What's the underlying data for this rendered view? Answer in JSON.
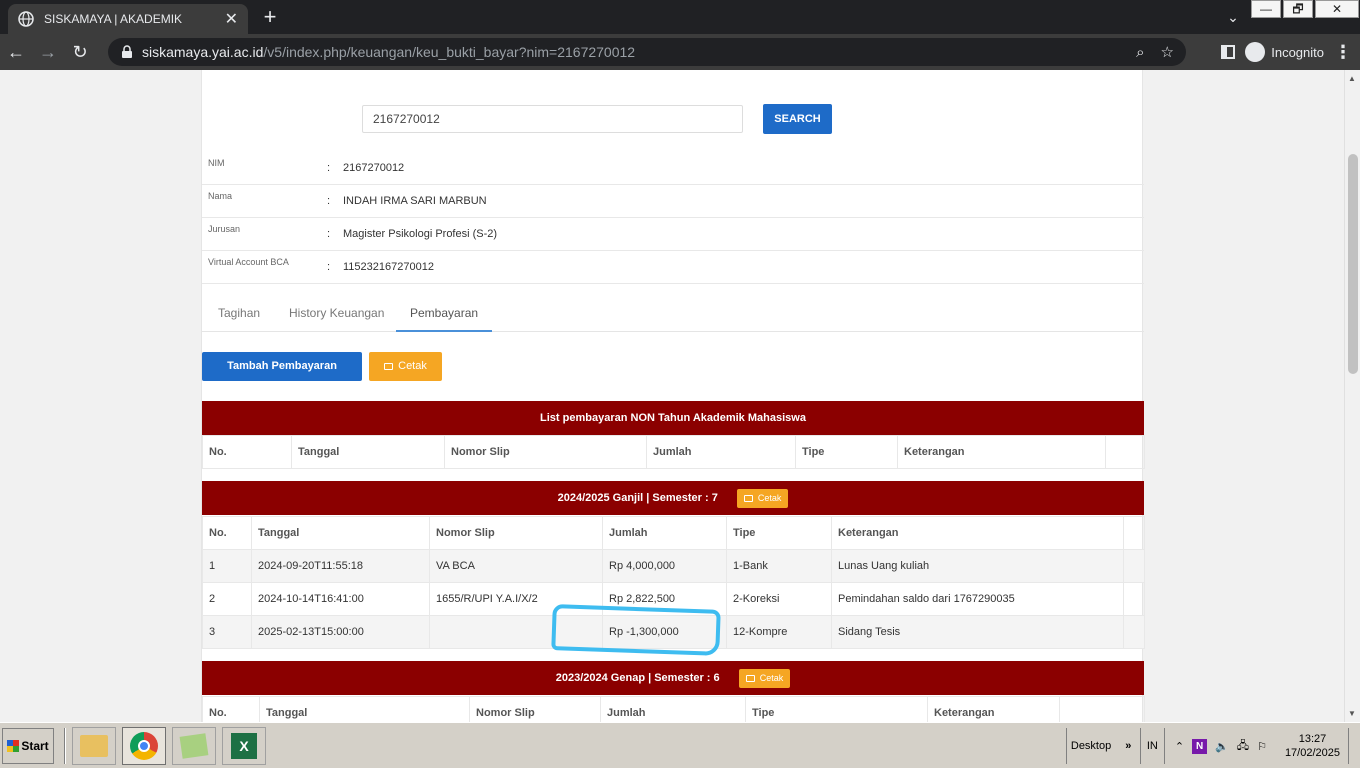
{
  "browser": {
    "tab_title": "SISKAMAYA | AKADEMIK",
    "tab_close": "✕",
    "new_tab": "+",
    "url_host": "siskamaya.yai.ac.id",
    "url_path": "/v5/index.php/keuangan/keu_bukti_bayar?nim=2167270012",
    "profile": "Incognito",
    "window_buttons": [
      "—",
      "🗗",
      "✕"
    ]
  },
  "search": {
    "value": "2167270012",
    "button_label": "SEARCH"
  },
  "student": [
    {
      "label": "NIM",
      "value": "2167270012"
    },
    {
      "label": "Nama",
      "value": "INDAH IRMA SARI MARBUN"
    },
    {
      "label": "Jurusan",
      "value": "Magister Psikologi Profesi (S-2)"
    },
    {
      "label": "Virtual Account BCA",
      "value": "115232167270012"
    }
  ],
  "colon": ":",
  "tabs": [
    "Tagihan",
    "History Keuangan",
    "Pembayaran"
  ],
  "active_tab": "Pembayaran",
  "actions": {
    "add_payment": "Tambah Pembayaran",
    "print": "Cetak"
  },
  "non_academic": {
    "title": "List pembayaran NON Tahun Akademik Mahasiswa",
    "columns": [
      "No.",
      "Tanggal",
      "Nomor Slip",
      "Jumlah",
      "Tipe",
      "Keterangan"
    ]
  },
  "semesters": [
    {
      "title": "2024/2025 Ganjil | Semester : 7",
      "print": "Cetak",
      "columns": [
        "No.",
        "Tanggal",
        "Nomor Slip",
        "Jumlah",
        "Tipe",
        "Keterangan"
      ],
      "rows": [
        [
          "1",
          "2024-09-20T11:55:18",
          "VA BCA",
          "Rp 4,000,000",
          "1-Bank",
          "Lunas Uang kuliah"
        ],
        [
          "2",
          "2024-10-14T16:41:00",
          "1655/R/UPI Y.A.I/X/2",
          "Rp 2,822,500",
          "2-Koreksi",
          "Pemindahan saldo dari 1767290035"
        ],
        [
          "3",
          "2025-02-13T15:00:00",
          "",
          "Rp -1,300,000",
          "12-Kompre",
          "Sidang Tesis"
        ]
      ]
    },
    {
      "title": "2023/2024 Genap | Semester : 6",
      "print": "Cetak",
      "columns": [
        "No.",
        "Tanggal",
        "Nomor Slip",
        "Jumlah",
        "Tipe",
        "Keterangan"
      ],
      "rows": []
    }
  ],
  "taskbar": {
    "start": "Start",
    "desktop": "Desktop",
    "desktop_chevron": "»",
    "lang": "IN",
    "time": "13:27",
    "date": "17/02/2025"
  },
  "colors": {
    "header_red": "#8b0000",
    "button_blue": "#1e6bc8",
    "button_orange": "#f5a623",
    "highlight": "#3ebcf0"
  }
}
